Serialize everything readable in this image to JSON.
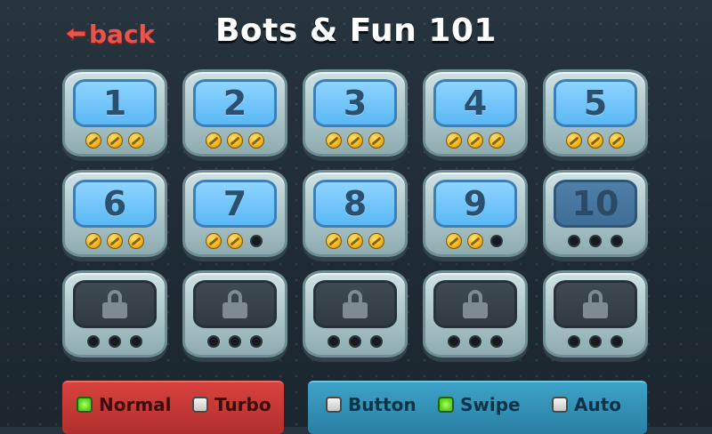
{
  "header": {
    "back_label": "back",
    "title": "Bots & Fun 101"
  },
  "levels": [
    {
      "label": "1",
      "state": "unlocked",
      "stars": 3
    },
    {
      "label": "2",
      "state": "unlocked",
      "stars": 3
    },
    {
      "label": "3",
      "state": "unlocked",
      "stars": 3
    },
    {
      "label": "4",
      "state": "unlocked",
      "stars": 3
    },
    {
      "label": "5",
      "state": "unlocked",
      "stars": 3
    },
    {
      "label": "6",
      "state": "unlocked",
      "stars": 3
    },
    {
      "label": "7",
      "state": "unlocked",
      "stars": 2
    },
    {
      "label": "8",
      "state": "unlocked",
      "stars": 3
    },
    {
      "label": "9",
      "state": "unlocked",
      "stars": 2
    },
    {
      "label": "10",
      "state": "current",
      "stars": 0
    },
    {
      "label": "",
      "state": "locked",
      "stars": 0
    },
    {
      "label": "",
      "state": "locked",
      "stars": 0
    },
    {
      "label": "",
      "state": "locked",
      "stars": 0
    },
    {
      "label": "",
      "state": "locked",
      "stars": 0
    },
    {
      "label": "",
      "state": "locked",
      "stars": 0
    }
  ],
  "speed_panel": {
    "options": [
      {
        "label": "Normal",
        "checked": true
      },
      {
        "label": "Turbo",
        "checked": false
      }
    ]
  },
  "control_panel": {
    "options": [
      {
        "label": "Button",
        "checked": false
      },
      {
        "label": "Swipe",
        "checked": true
      },
      {
        "label": "Auto",
        "checked": false
      }
    ]
  },
  "colors": {
    "back": "#e8544e",
    "screen": "#5ab8f5",
    "speed_panel": "#c53a36",
    "control_panel": "#3290b5",
    "checked": "#52d21f"
  }
}
